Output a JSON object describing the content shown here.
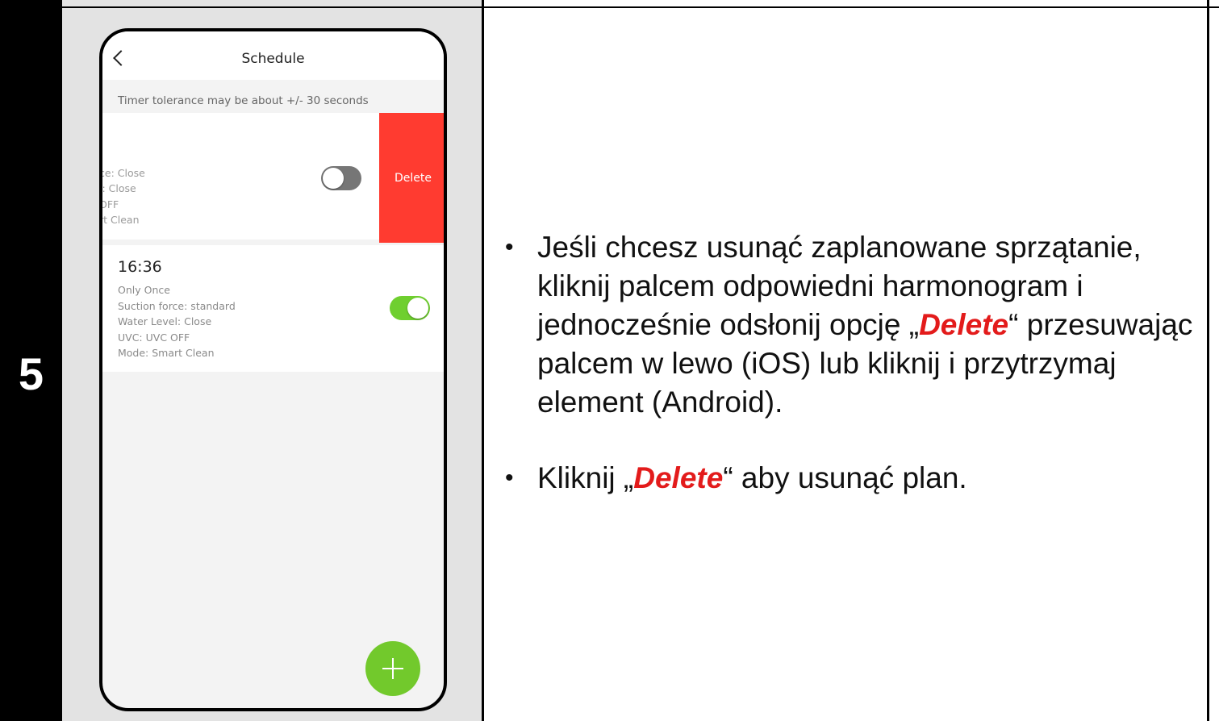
{
  "step": {
    "number": "5"
  },
  "phone": {
    "nav_title": "Schedule",
    "tolerance_note": "Timer tolerance may be about +/- 30 seconds",
    "swiped_schedule": {
      "lines": [
        "ce: Close",
        "l: Close",
        "OFF",
        "rt Clean"
      ],
      "toggle": "off",
      "delete_label": "Delete"
    },
    "schedule": {
      "time": "16:36",
      "repeat": "Only Once",
      "suction": "Suction force: standard",
      "water": "Water Level: Close",
      "uvc": "UVC: UVC OFF",
      "mode": "Mode: Smart Clean",
      "toggle": "on"
    },
    "add_icon": "plus-icon"
  },
  "instructions": {
    "bullet1_part1": "Jeśli chcesz usunąć zaplanowane sprzątanie, kliknij palcem odpowiedni harmonogram i jednocześnie odsłonij opcję „",
    "bullet1_emph": "Delete",
    "bullet1_part2": "“ przesuwając palcem w lewo (iOS) lub kliknij i przytrzymaj element (Android).",
    "bullet2_part1": "Kliknij „",
    "bullet2_emph": "Delete",
    "bullet2_part2": "“ aby usunąć plan.",
    "bullet_char": "•"
  },
  "colors": {
    "delete_red": "#ff3b30",
    "toggle_on": "#6fcf2f",
    "fab_green": "#72c92c",
    "emphasis_red": "#e31b1b"
  }
}
